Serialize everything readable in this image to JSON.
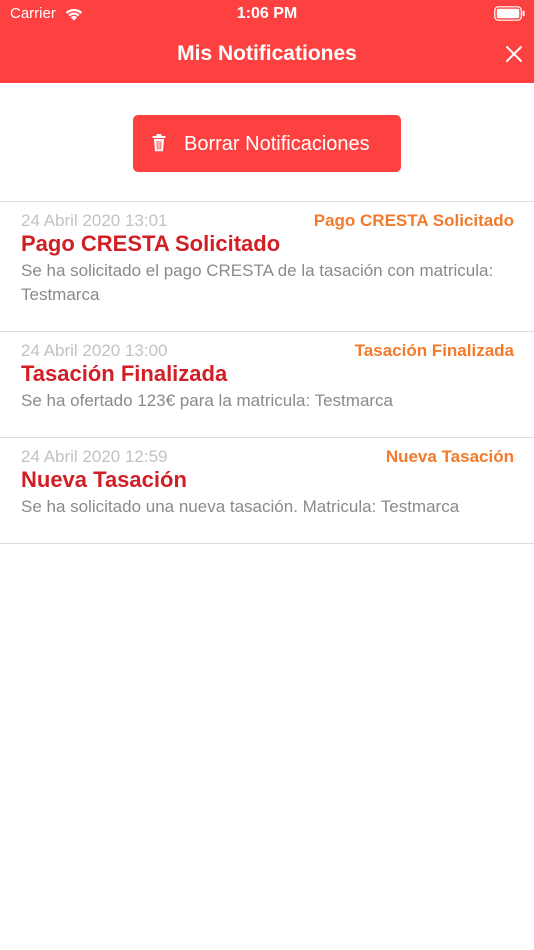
{
  "status_bar": {
    "carrier": "Carrier",
    "time": "1:06 PM"
  },
  "header": {
    "title": "Mis Notificationes"
  },
  "actions": {
    "clear_label": "Borrar Notificaciones"
  },
  "notifications": [
    {
      "date": "24 Abril 2020 13:01",
      "type": "Pago CRESTA Solicitado",
      "title": "Pago CRESTA Solicitado",
      "body": "Se ha solicitado el pago CRESTA de la tasación con matricula: Testmarca"
    },
    {
      "date": "24 Abril 2020 13:00",
      "type": "Tasación Finalizada",
      "title": "Tasación Finalizada",
      "body": "Se ha ofertado 123€ para la matricula: Testmarca"
    },
    {
      "date": "24 Abril 2020 12:59",
      "type": "Nueva Tasación",
      "title": "Nueva Tasación",
      "body": "Se ha solicitado una nueva tasación. Matricula: Testmarca"
    }
  ],
  "colors": {
    "accent": "#fd4141",
    "title_red": "#d11f26",
    "type_orange": "#f37a2a",
    "date_gray": "#c2c2c2",
    "body_gray": "#8a8a8a"
  },
  "icons": {
    "wifi": "wifi-icon",
    "battery": "battery-icon",
    "close": "close-icon",
    "trash": "trash-icon"
  }
}
